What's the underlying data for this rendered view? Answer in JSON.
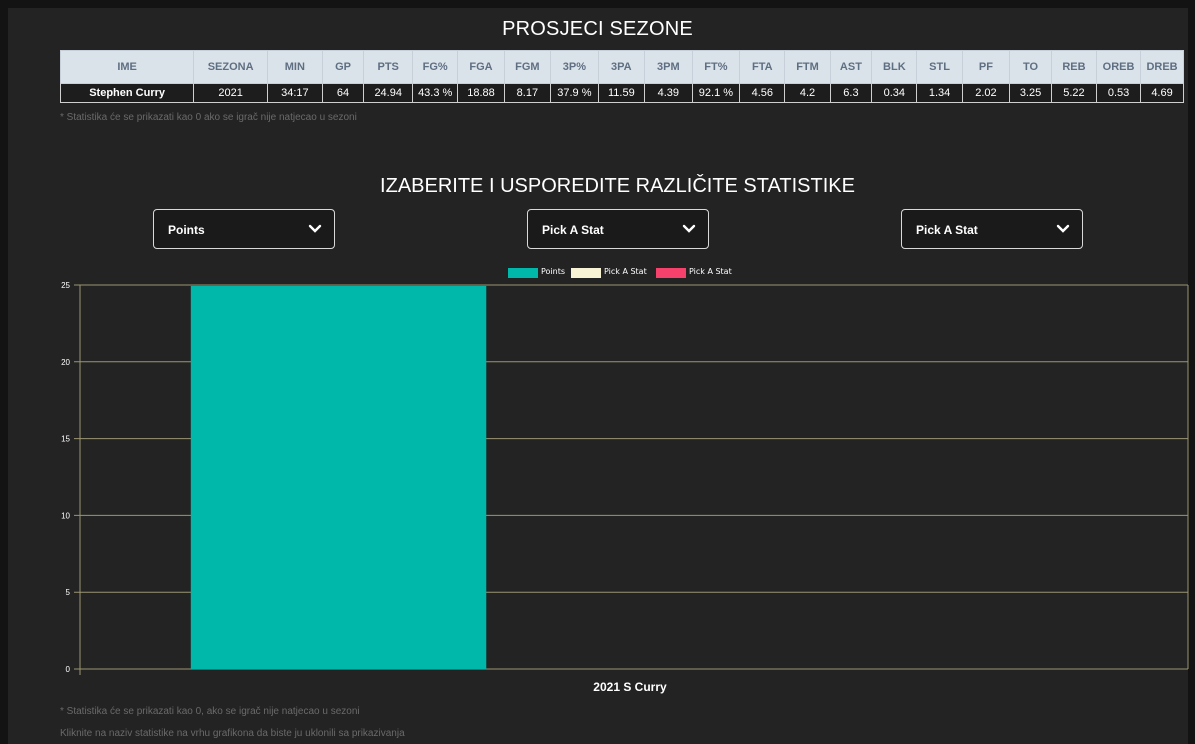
{
  "page_title": "PROSJECI SEZONE",
  "table": {
    "headers": [
      "IME",
      "SEZONA",
      "MIN",
      "GP",
      "PTS",
      "FG%",
      "FGA",
      "FGM",
      "3P%",
      "3PA",
      "3PM",
      "FT%",
      "FTA",
      "FTM",
      "AST",
      "BLK",
      "STL",
      "PF",
      "TO",
      "REB",
      "OREB",
      "DREB"
    ],
    "rows": [
      [
        "Stephen Curry",
        "2021",
        "34:17",
        "64",
        "24.94",
        "43.3 %",
        "18.88",
        "8.17",
        "37.9 %",
        "11.59",
        "4.39",
        "92.1 %",
        "4.56",
        "4.2",
        "6.3",
        "0.34",
        "1.34",
        "2.02",
        "3.25",
        "5.22",
        "0.53",
        "4.69"
      ]
    ]
  },
  "table_note": "* Statistika će se prikazati kao 0 ako se igrač nije natjecao u sezoni",
  "compare_title": "IZABERITE I USPOREDITE RAZLIČITE STATISTIKE",
  "selects": [
    {
      "value": "Points"
    },
    {
      "value": "Pick A Stat"
    },
    {
      "value": "Pick A Stat"
    }
  ],
  "chart_data": {
    "type": "bar",
    "categories": [
      "2021 S Curry"
    ],
    "series": [
      {
        "name": "Points",
        "values": [
          24.94
        ],
        "color": "#00b8a9"
      },
      {
        "name": "Pick A Stat",
        "values": [
          0
        ],
        "color": "#f8f3d4"
      },
      {
        "name": "Pick A Stat",
        "values": [
          0
        ],
        "color": "#f6416c"
      }
    ],
    "yticks": [
      0,
      5,
      10,
      15,
      20,
      25
    ],
    "ylim": [
      0,
      25
    ],
    "grid": true,
    "legend_position": "top"
  },
  "footer_notes": [
    "* Statistika će se prikazati kao 0, ako se igrač nije natjecao u sezoni",
    "Kliknite na naziv statistike na vrhu grafikona da biste ju uklonili sa prikazivanja"
  ],
  "icons": {
    "select_chevron": "chevron-down-icon"
  }
}
